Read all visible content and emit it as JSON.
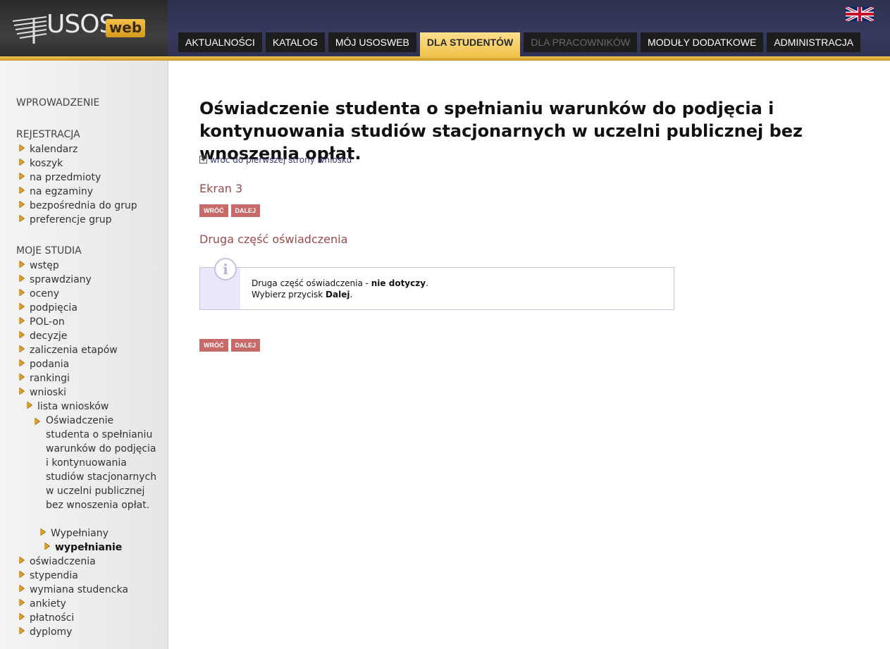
{
  "header": {
    "logo_text": "USOS",
    "logo_badge": "web",
    "tabs": [
      {
        "label": "AKTUALNOŚCI",
        "state": "normal"
      },
      {
        "label": "KATALOG",
        "state": "normal"
      },
      {
        "label": "MÓJ USOSWEB",
        "state": "normal"
      },
      {
        "label": "DLA STUDENTÓW",
        "state": "active"
      },
      {
        "label": "DLA PRACOWNIKÓW",
        "state": "disabled"
      },
      {
        "label": "MODUŁY DODATKOWE",
        "state": "normal"
      },
      {
        "label": "ADMINISTRACJA",
        "state": "normal"
      }
    ],
    "language_flag_icon": "uk-flag-icon"
  },
  "sidebar": {
    "intro": "WPROWADZENIE",
    "registration": {
      "title": "REJESTRACJA",
      "items": [
        "kalendarz",
        "koszyk",
        "na przedmioty",
        "na egzaminy",
        "bezpośrednia do grup",
        "preferencje grup"
      ]
    },
    "my_studies": {
      "title": "MOJE STUDIA",
      "items": [
        "wstęp",
        "sprawdziany",
        "oceny",
        "podpięcia",
        "POL-on",
        "decyzje",
        "zaliczenia etapów",
        "podania",
        "rankingi",
        "wnioski"
      ],
      "sub_list": "lista wniosków",
      "sub_statement": "Oświadczenie studenta o spełnianiu warunków do podjęcia i kontynuowania studiów stacjonarnych w uczelni publicznej bez wnoszenia opłat.",
      "sub_filled": "Wypełniany",
      "sub_filling": "wypełnianie",
      "items_after": [
        "oświadczenia",
        "stypendia",
        "wymiana studencka",
        "ankiety",
        "płatności",
        "dyplomy"
      ]
    }
  },
  "main": {
    "title": "Oświadczenie studenta o spełnianiu warunków do podjęcia i kontynuowania studiów stacjonarnych w uczelni publicznej bez wnoszenia opłat.",
    "back_link": "wróć do pierwszej strony wniosku",
    "screen_label": "Ekran 3",
    "btn_back": "WRÓĆ",
    "btn_next": "DALEJ",
    "section_heading": "Druga część oświadczenia",
    "info": {
      "line1_prefix": "Druga część oświadczenia - ",
      "line1_bold": "nie dotyczy",
      "line1_suffix": ".",
      "line2_prefix": "Wybierz przycisk ",
      "line2_bold": "Dalej",
      "line2_suffix": "."
    }
  },
  "colors": {
    "header_bg": "#2c2f4d",
    "accent_gold": "#f2c24b",
    "heading_red": "#9b4a4a",
    "button_red": "#c86a6a",
    "link_blue": "#333a7a"
  }
}
